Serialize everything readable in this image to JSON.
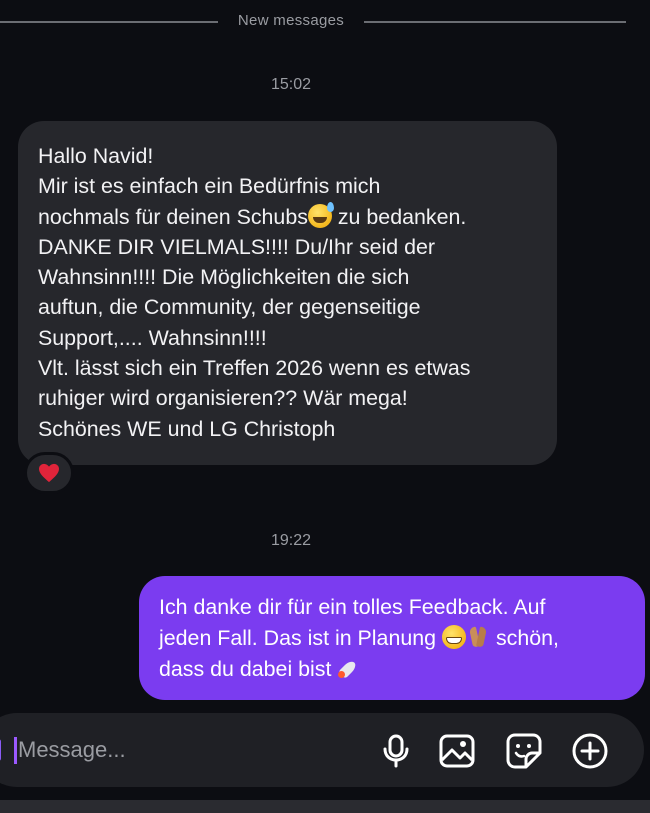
{
  "divider": {
    "label": "New messages"
  },
  "messages": [
    {
      "time": "15:02",
      "direction": "incoming",
      "lines": [
        "Hallo Navid!",
        "Mir ist es einfach ein Bedürfnis mich",
        "nochmals für deinen Schubs",
        " zu bedanken.",
        "DANKE DIR VIELMALS!!!! Du/Ihr seid der",
        "Wahnsinn!!!! Die Möglichkeiten die sich",
        "auftun, die Community, der gegenseitige",
        "Support,....  Wahnsinn!!!!",
        "Vlt. lässt sich ein Treffen 2026 wenn es etwas",
        "ruhiger wird organisieren?? Wär mega!",
        "Schönes WE und LG Christoph"
      ],
      "reaction": "heart"
    },
    {
      "time": "19:22",
      "direction": "outgoing",
      "lines": [
        "Ich danke dir für ein tolles Feedback. Auf",
        "jeden Fall. Das ist in Planung ",
        " schön,",
        "dass du dabei bist "
      ]
    }
  ],
  "composer": {
    "placeholder": "Message...",
    "icons": [
      "microphone-icon",
      "image-icon",
      "sticker-icon",
      "plus-icon"
    ]
  },
  "colors": {
    "background": "#0c0d12",
    "incoming_bubble": "#26272c",
    "outgoing_bubble": "#7b3cf0",
    "accent": "#8b5cf6",
    "reaction_heart": "#e0243a"
  }
}
